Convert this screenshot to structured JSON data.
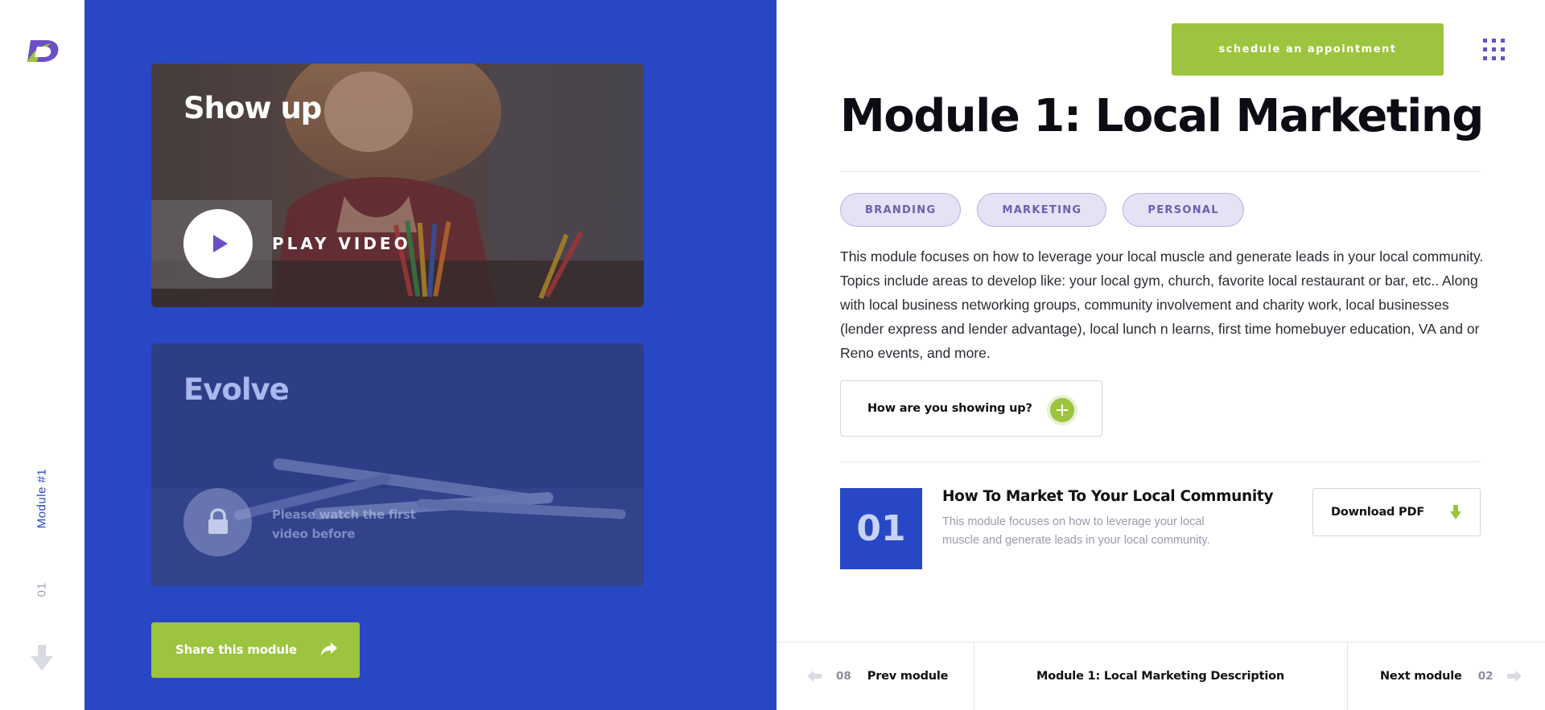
{
  "rail": {
    "logo": "brand-logo",
    "module_label": "Module #1",
    "module_number": "01",
    "scroll_icon": "arrow-down-icon"
  },
  "colors": {
    "primary_blue": "#2747c4",
    "accent_green": "#9cc43e",
    "accent_purple": "#6b4fc4",
    "tag_bg": "#e4e2f4"
  },
  "cards": {
    "video": {
      "title": "Show up",
      "play_label": "PLAY VIDEO",
      "icon": "play-icon"
    },
    "locked": {
      "title": "Evolve",
      "message": "Please watch the first video before",
      "icon": "lock-icon"
    }
  },
  "share": {
    "label": "Share this module",
    "icon": "share-arrow-icon"
  },
  "header": {
    "appointment_label": "schedule an appointment",
    "menu_icon": "grid-menu-icon"
  },
  "module": {
    "title": "Module 1: Local Marketing",
    "tags": [
      "BRANDING",
      "MARKETING",
      "PERSONAL"
    ],
    "description": "This module focuses on how to leverage your local muscle and generate leads in your local community. Topics include areas to develop like: your local gym, church, favorite local restaurant or bar, etc.. Along with local business networking groups, community involvement and charity work, local businesses (lender express and lender advantage), local lunch n learns, first time homebuyer education, VA and or Reno events, and more.",
    "accordion_label": "How are you showing up?"
  },
  "lesson": {
    "number": "01",
    "title": "How To Market To Your Local Community",
    "description": "This module focuses on how to leverage your local muscle and generate leads in your local community.",
    "download_label": "Download PDF",
    "download_icon": "download-arrow-icon"
  },
  "bottom_nav": {
    "prev_number": "08",
    "prev_label": "Prev module",
    "current_label": "Module 1: Local Marketing Description",
    "next_label": "Next module",
    "next_number": "02"
  }
}
